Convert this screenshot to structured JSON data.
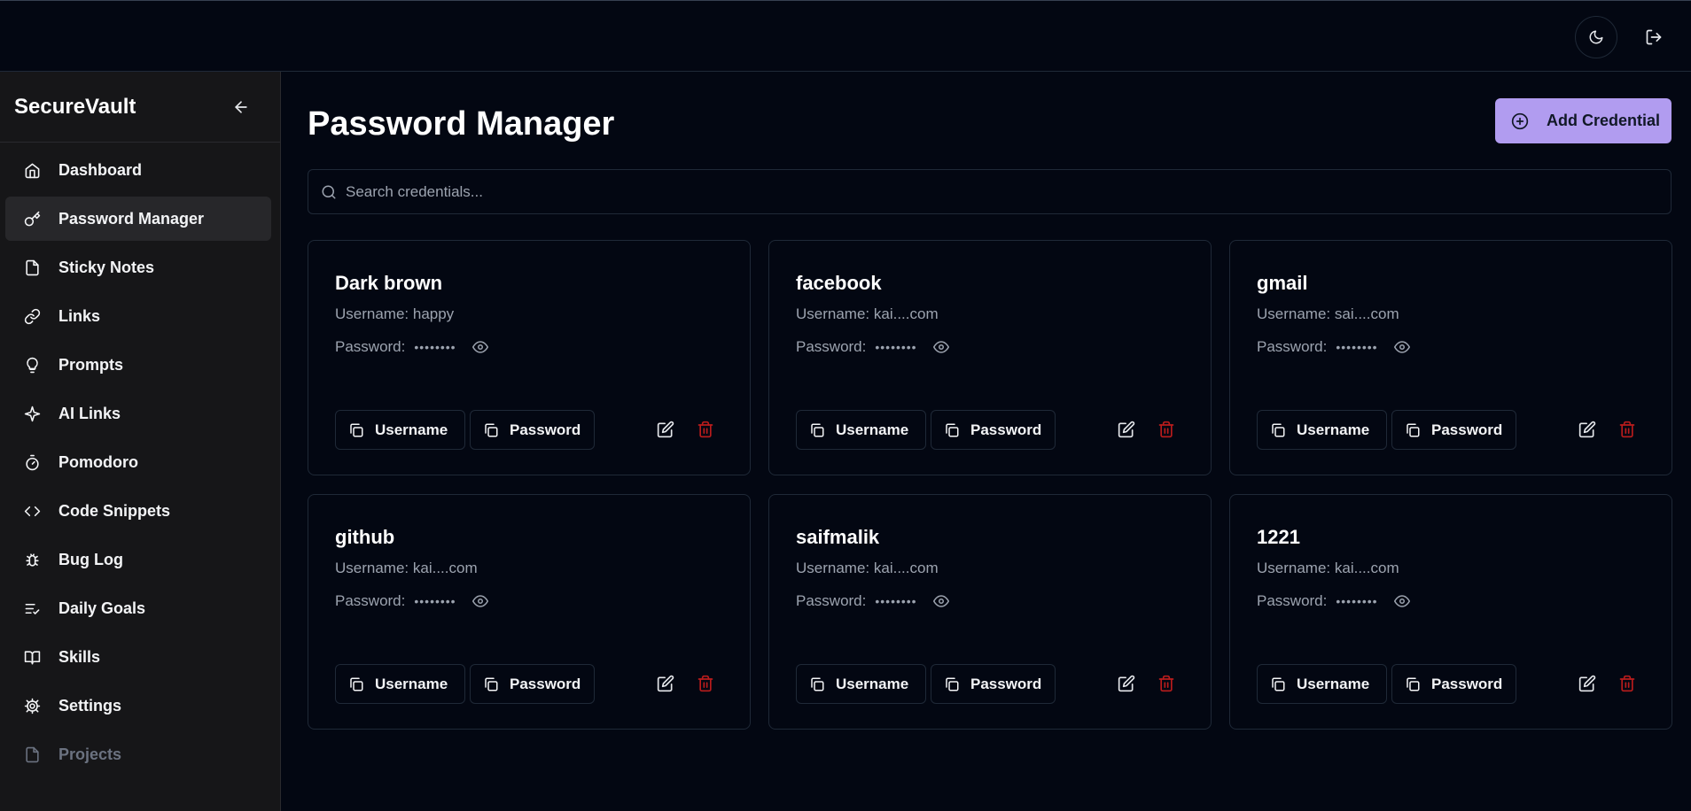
{
  "header": {
    "theme_icon": "moon-icon",
    "logout_icon": "logout-icon"
  },
  "sidebar": {
    "brand": "SecureVault",
    "items": [
      {
        "label": "Dashboard",
        "icon": "home-icon"
      },
      {
        "label": "Password Manager",
        "icon": "key-icon"
      },
      {
        "label": "Sticky Notes",
        "icon": "file-icon"
      },
      {
        "label": "Links",
        "icon": "link-icon"
      },
      {
        "label": "Prompts",
        "icon": "lightbulb-icon"
      },
      {
        "label": "AI Links",
        "icon": "sparkle-icon"
      },
      {
        "label": "Pomodoro",
        "icon": "timer-icon"
      },
      {
        "label": "Code Snippets",
        "icon": "code-icon"
      },
      {
        "label": "Bug Log",
        "icon": "bug-icon"
      },
      {
        "label": "Daily Goals",
        "icon": "list-check-icon"
      },
      {
        "label": "Skills",
        "icon": "book-icon"
      },
      {
        "label": "Settings",
        "icon": "gear-icon"
      },
      {
        "label": "Projects",
        "icon": "file-icon"
      }
    ]
  },
  "main": {
    "title": "Password Manager",
    "add_button": "Add Credential",
    "search_placeholder": "Search credentials...",
    "copy_username_label": "Username",
    "copy_password_label": "Password",
    "password_label": "Password:",
    "password_mask": "••••••••",
    "credentials": [
      {
        "name": "Dark brown",
        "username": "Username: happy"
      },
      {
        "name": "facebook",
        "username": "Username: kai....com"
      },
      {
        "name": "gmail",
        "username": "Username: sai....com"
      },
      {
        "name": "github",
        "username": "Username: kai....com"
      },
      {
        "name": "saifmalik",
        "username": "Username: kai....com"
      },
      {
        "name": "1221",
        "username": "Username: kai....com"
      }
    ]
  },
  "colors": {
    "background": "#030712",
    "sidebar": "#161618",
    "accent": "#b19cf0",
    "danger": "#b91c1c"
  }
}
